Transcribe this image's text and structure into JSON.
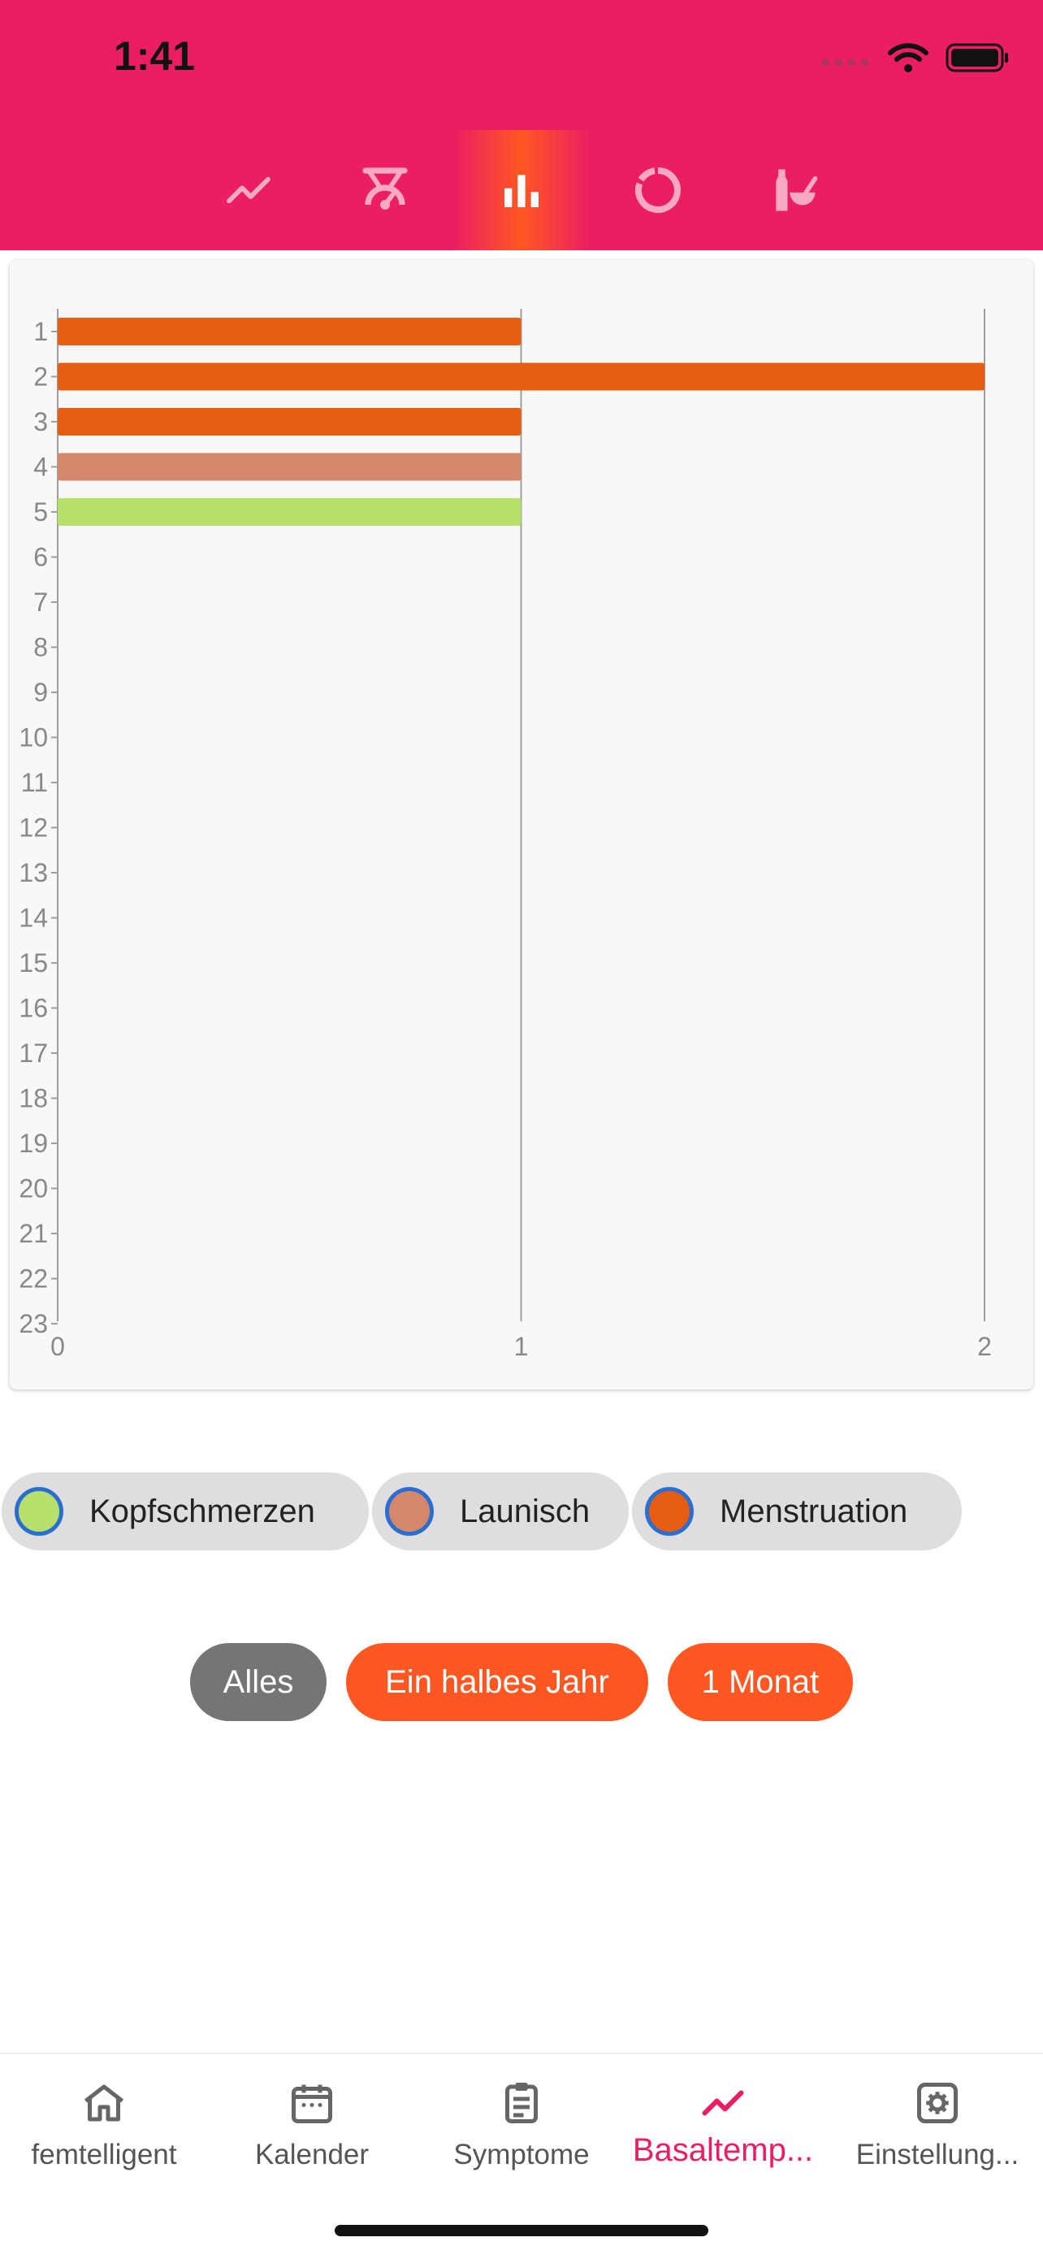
{
  "status_bar": {
    "time": "1:41"
  },
  "tabs": [
    {
      "icon": "line-chart-icon",
      "active": false
    },
    {
      "icon": "thermometer-gauge-icon",
      "active": false
    },
    {
      "icon": "bar-chart-icon",
      "active": true
    },
    {
      "icon": "ring-chart-icon",
      "active": false
    },
    {
      "icon": "bottle-mortar-icon",
      "active": false
    }
  ],
  "chart_data": {
    "type": "bar",
    "orientation": "horizontal",
    "categories": [
      "1",
      "2",
      "3",
      "4",
      "5",
      "6",
      "7",
      "8",
      "9",
      "10",
      "11",
      "12",
      "13",
      "14",
      "15",
      "16",
      "17",
      "18",
      "19",
      "20",
      "21",
      "22",
      "23"
    ],
    "x_ticks": [
      "0",
      "1",
      "2"
    ],
    "xlim": [
      0,
      2
    ],
    "grid": "vertical",
    "bars": [
      {
        "category": "1",
        "value": 1,
        "color": "#E55C12",
        "series": "Menstruation"
      },
      {
        "category": "2",
        "value": 2,
        "color": "#E55C12",
        "series": "Menstruation"
      },
      {
        "category": "3",
        "value": 1,
        "color": "#E55C12",
        "series": "Menstruation"
      },
      {
        "category": "4",
        "value": 1,
        "color": "#D4876A",
        "series": "Launisch"
      },
      {
        "category": "5",
        "value": 1,
        "color": "#B8E06C",
        "series": "Kopfschmerzen"
      }
    ]
  },
  "legend": [
    {
      "label": "Kopfschmerzen",
      "color": "#B8E06C"
    },
    {
      "label": "Launisch",
      "color": "#D4876A"
    },
    {
      "label": "Menstruation",
      "color": "#E55C12"
    }
  ],
  "ranges": [
    {
      "label": "Alles",
      "color": "#757575"
    },
    {
      "label": "Ein halbes Jahr",
      "color": "#FF5722"
    },
    {
      "label": "1 Monat",
      "color": "#FF5722"
    }
  ],
  "bottom_nav": [
    {
      "label": "femtelligent",
      "icon": "home-icon",
      "active": false
    },
    {
      "label": "Kalender",
      "icon": "calendar-icon",
      "active": false
    },
    {
      "label": "Symptome",
      "icon": "clipboard-icon",
      "active": false
    },
    {
      "label": "Basaltemp...",
      "icon": "trend-icon",
      "active": true
    },
    {
      "label": "Einstellung...",
      "icon": "settings-icon",
      "active": false
    }
  ],
  "colors": {
    "header": "#EB1E63",
    "accent": "#FF5722",
    "nav_active": "#E91E63"
  }
}
